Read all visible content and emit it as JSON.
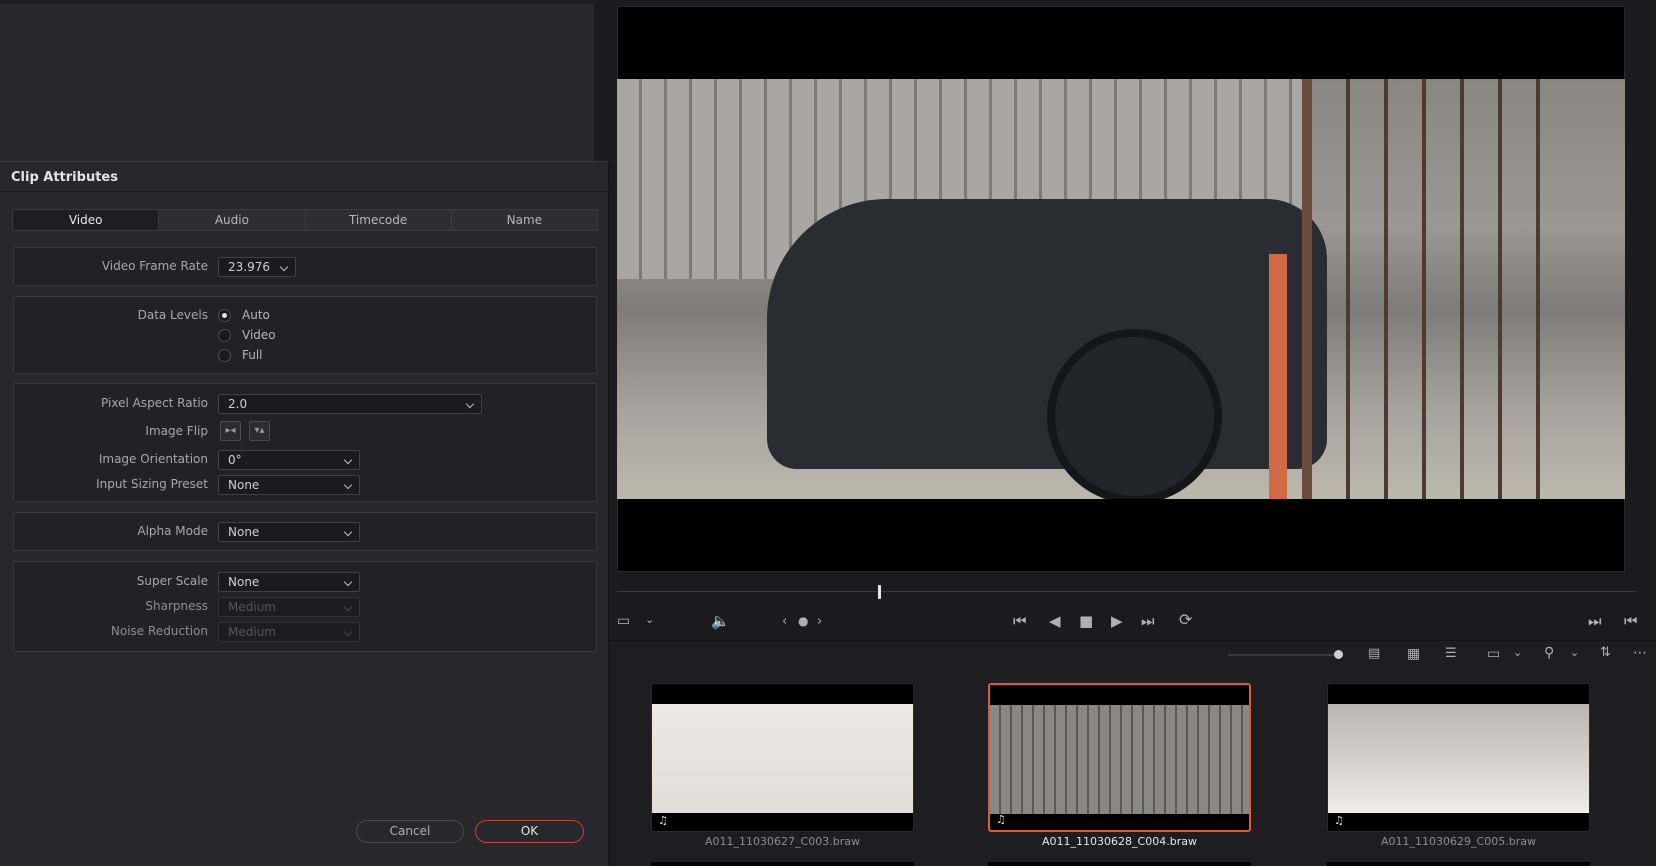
{
  "dialog": {
    "title": "Clip Attributes",
    "tabs": [
      "Video",
      "Audio",
      "Timecode",
      "Name"
    ],
    "active_tab": "Video",
    "video_frame_rate": {
      "label": "Video Frame Rate",
      "value": "23.976"
    },
    "data_levels": {
      "label": "Data Levels",
      "options": [
        "Auto",
        "Video",
        "Full"
      ],
      "selected": "Auto"
    },
    "pixel_aspect_ratio": {
      "label": "Pixel Aspect Ratio",
      "value": "2.0"
    },
    "image_flip": {
      "label": "Image Flip"
    },
    "image_orientation": {
      "label": "Image Orientation",
      "value": "0°"
    },
    "input_sizing_preset": {
      "label": "Input Sizing Preset",
      "value": "None"
    },
    "alpha_mode": {
      "label": "Alpha Mode",
      "value": "None"
    },
    "super_scale": {
      "label": "Super Scale",
      "value": "None"
    },
    "sharpness": {
      "label": "Sharpness",
      "value": "Medium"
    },
    "noise_reduction": {
      "label": "Noise Reduction",
      "value": "Medium"
    },
    "cancel_label": "Cancel",
    "ok_label": "OK"
  },
  "clips": [
    {
      "name": "A011_11030627_C003.braw",
      "selected": false
    },
    {
      "name": "A011_11030628_C004.braw",
      "selected": true
    },
    {
      "name": "A011_11030629_C005.braw",
      "selected": false
    }
  ],
  "colors": {
    "accent": "#e0583e",
    "ok_border": "#c4423e",
    "panel": "#28282c",
    "background": "#1b1b1e"
  },
  "icons": {
    "note": "♫",
    "viewer_controls": [
      "film-icon",
      "chevron-down-icon",
      "speaker-icon",
      "prev-marker-icon",
      "marker-dot-icon",
      "next-marker-icon",
      "skip-start-icon",
      "step-back-icon",
      "stop-icon",
      "play-icon",
      "skip-end-icon",
      "loop-icon",
      "go-to-end-icon",
      "go-to-start-icon"
    ],
    "bin_controls": [
      "metadata-view-icon",
      "thumbnail-view-icon",
      "list-view-icon",
      "aspect-icon",
      "search-icon",
      "sort-icon",
      "more-icon"
    ]
  }
}
